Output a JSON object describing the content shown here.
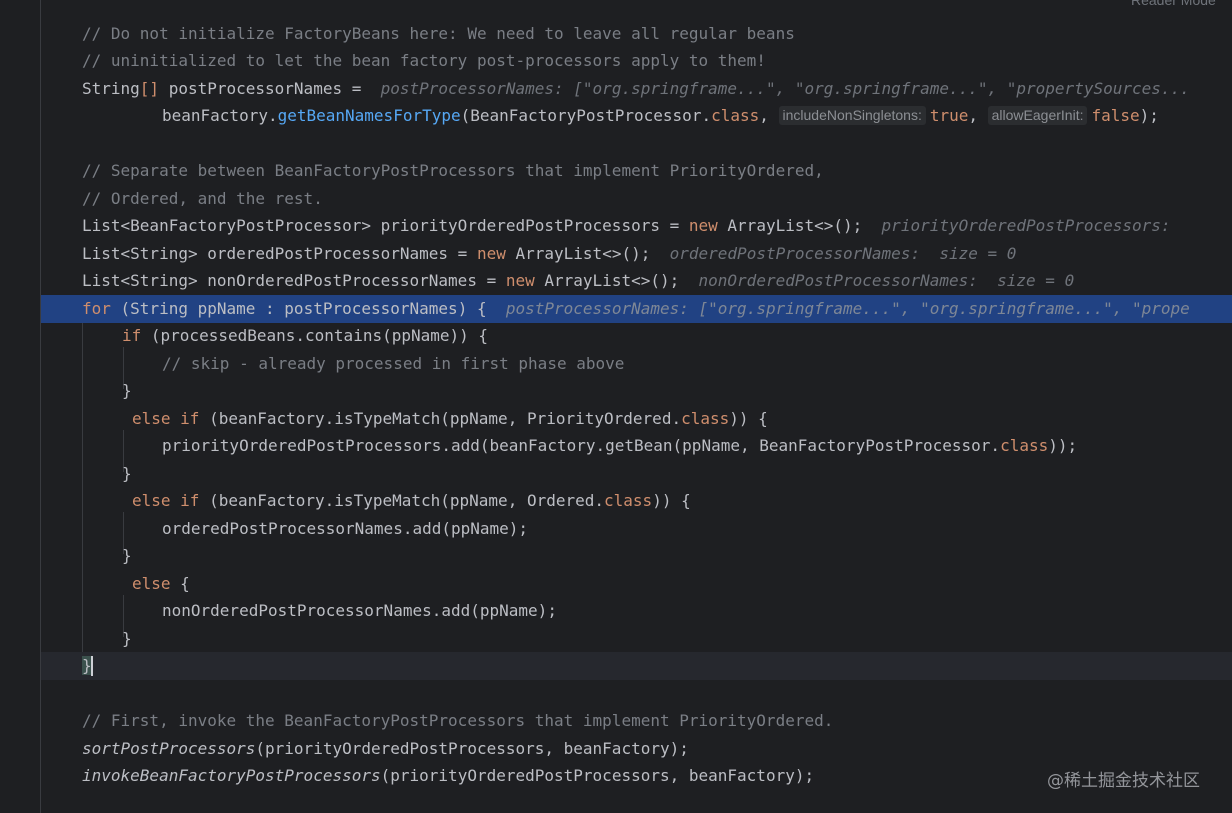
{
  "toolbar": {
    "reader_mode": "Reader Mode"
  },
  "watermark": "@稀土掘金技术社区",
  "code": {
    "l1": "// Do not initialize FactoryBeans here: We need to leave all regular beans",
    "l2": "// uninitialized to let the bean factory post-processors apply to them!",
    "l3_type": "String",
    "l3_bracket": "[]",
    "l3_var": " postProcessorNames = ",
    "l3_hint": "postProcessorNames: [\"org.springframe...\", \"org.springframe...\", \"propertySources...",
    "l4_pre": "beanFactory.",
    "l4_fn": "getBeanNamesForType",
    "l4_arg": "(BeanFactoryPostProcessor.",
    "l4_class": "class",
    "l4_comma": ", ",
    "l4_pill1": "includeNonSingletons:",
    "l4_true": "true",
    "l4_comma2": ", ",
    "l4_pill2": "allowEagerInit:",
    "l4_false": "false",
    "l4_end": ");",
    "l6": "// Separate between BeanFactoryPostProcessors that implement PriorityOrdered,",
    "l7": "// Ordered, and the rest.",
    "l8_a": "List<BeanFactoryPostProcessor> priorityOrderedPostProcessors = ",
    "l8_new": "new",
    "l8_b": " ArrayList<>();",
    "l8_hint": "priorityOrderedPostProcessors:",
    "l9_a": "List<String> orderedPostProcessorNames = ",
    "l9_new": "new",
    "l9_b": " ArrayList<>();",
    "l9_hint": "orderedPostProcessorNames:  size = 0",
    "l10_a": "List<String> nonOrderedPostProcessorNames = ",
    "l10_new": "new",
    "l10_b": " ArrayList<>();",
    "l10_hint": "nonOrderedPostProcessorNames:  size = 0",
    "l11_for": "for",
    "l11_b": " (String ppName : postProcessorNames) {",
    "l11_hint": "postProcessorNames: [\"org.springframe...\", \"org.springframe...\", \"prope",
    "l12_if": "if",
    "l12_b": " (processedBeans.contains(ppName)) {",
    "l13": "// skip - already processed in first phase above",
    "l14": "}",
    "l15_else": "else if",
    "l15_b": " (beanFactory.isTypeMatch(ppName, PriorityOrdered.",
    "l15_class": "class",
    "l15_c": ")) {",
    "l16_a": "priorityOrderedPostProcessors.add(beanFactory.getBean(ppName, BeanFactoryPostProcessor.",
    "l16_class": "class",
    "l16_b": "));",
    "l17": "}",
    "l18_else": "else if",
    "l18_b": " (beanFactory.isTypeMatch(ppName, Ordered.",
    "l18_class": "class",
    "l18_c": ")) {",
    "l19": "orderedPostProcessorNames.add(ppName);",
    "l20": "}",
    "l21_else": "else",
    "l21_b": " {",
    "l22": "nonOrderedPostProcessorNames.add(ppName);",
    "l23": "}",
    "l24": "}",
    "l26": "// First, invoke the BeanFactoryPostProcessors that implement PriorityOrdered.",
    "l27_fn": "sortPostProcessors",
    "l27_b": "(priorityOrderedPostProcessors, beanFactory);",
    "l28_fn": "invokeBeanFactoryPostProcessors",
    "l28_b": "(priorityOrderedPostProcessors, beanFactory);"
  }
}
